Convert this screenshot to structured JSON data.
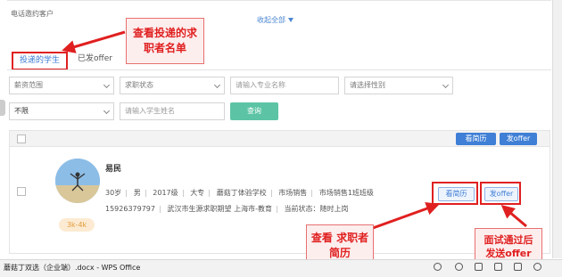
{
  "header": {
    "phone_label": "电话邀约客户",
    "collapse_label": "收起全部"
  },
  "tabs": [
    {
      "label": "投递的学生",
      "active": true
    },
    {
      "label": "已发offer",
      "active": false
    }
  ],
  "filters": {
    "salary": "薪资范围",
    "job_status": "求职状态",
    "major_placeholder": "请输入专业名称",
    "gender": "请选择性别",
    "limit": "不限",
    "name_placeholder": "请输入学生姓名",
    "search_label": "查询"
  },
  "toolbar": {
    "view_resume": "看简历",
    "send_offer": "发offer"
  },
  "candidate": {
    "name": "易民",
    "age": "30岁",
    "gender": "男",
    "grade": "2017级",
    "education": "大专",
    "school": "蘑菇丁体验学校",
    "major": "市场销售",
    "class": "市场销售1班班级",
    "phone": "15926379797",
    "intention": "武汉市生源求职期望 上海市-教育",
    "status": "当前状态：随时上岗",
    "salary": "3k-4k",
    "view_resume": "看简历",
    "send_offer": "发offer"
  },
  "annotations": {
    "view_candidates": [
      "查看投递的求",
      "职者名单"
    ],
    "view_resume": [
      "查看 求职者",
      "简历"
    ],
    "send_offer": [
      "面试通过后",
      "发送offer"
    ]
  },
  "taskbar": {
    "title": "蘑菇丁双选（企业端）.docx - WPS Office"
  },
  "colors": {
    "accent_blue": "#3f7fd6",
    "search_green": "#5cc4a5",
    "annotation_red": "#e02020",
    "salary_orange": "#e39a3a"
  }
}
